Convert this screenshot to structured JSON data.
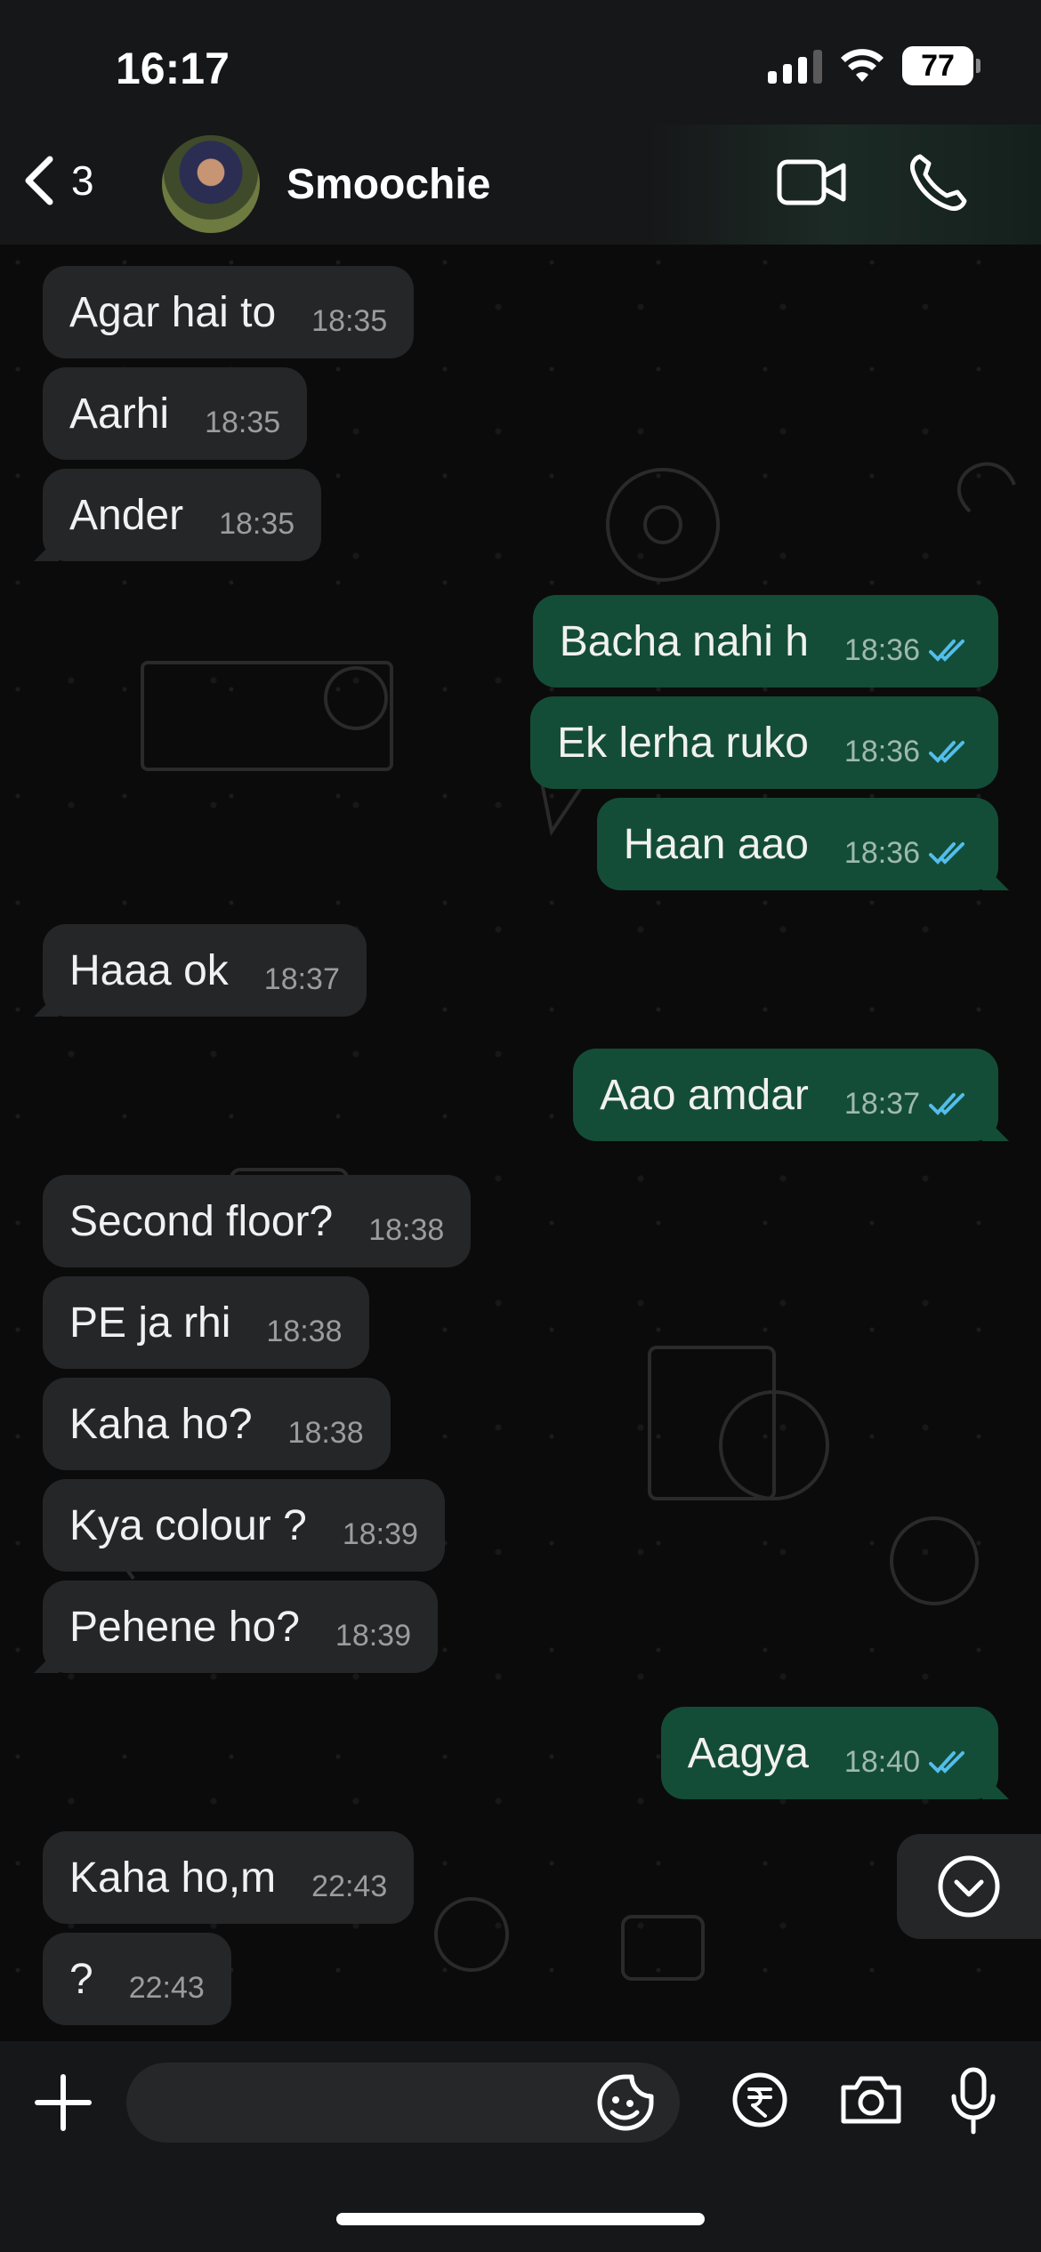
{
  "status_bar": {
    "time": "16:17",
    "battery": "77"
  },
  "header": {
    "back_count": "3",
    "contact_name": "Smoochie",
    "icons": {
      "back": "chevron-left-icon",
      "video": "video-camera-icon",
      "call": "phone-icon"
    }
  },
  "messages": [
    {
      "direction": "in",
      "text": "Agar hai to",
      "time": "18:35"
    },
    {
      "direction": "in",
      "text": "Aarhi",
      "time": "18:35"
    },
    {
      "direction": "in",
      "text": "Ander",
      "time": "18:35"
    },
    {
      "direction": "out",
      "text": "Bacha nahi h",
      "time": "18:36",
      "status": "read"
    },
    {
      "direction": "out",
      "text": "Ek lerha ruko",
      "time": "18:36",
      "status": "read"
    },
    {
      "direction": "out",
      "text": "Haan aao",
      "time": "18:36",
      "status": "read"
    },
    {
      "direction": "in",
      "text": "Haaa ok",
      "time": "18:37"
    },
    {
      "direction": "out",
      "text": "Aao amdar",
      "time": "18:37",
      "status": "read"
    },
    {
      "direction": "in",
      "text": "Second floor?",
      "time": "18:38"
    },
    {
      "direction": "in",
      "text": "PE ja rhi",
      "time": "18:38"
    },
    {
      "direction": "in",
      "text": "Kaha ho?",
      "time": "18:38"
    },
    {
      "direction": "in",
      "text": "Kya colour ?",
      "time": "18:39"
    },
    {
      "direction": "in",
      "text": "Pehene ho?",
      "time": "18:39"
    },
    {
      "direction": "out",
      "text": "Aagya",
      "time": "18:40",
      "status": "read"
    },
    {
      "direction": "in",
      "text": "Kaha ho,m",
      "time": "22:43"
    },
    {
      "direction": "in",
      "text": "?",
      "time": "22:43"
    }
  ],
  "composer": {
    "placeholder": "",
    "icons": {
      "attach": "plus-icon",
      "sticker": "sticker-icon",
      "payment": "rupee-icon",
      "camera": "camera-icon",
      "voice": "microphone-icon"
    }
  },
  "colors": {
    "incoming_bubble": "#242628",
    "outgoing_bubble": "#144d37",
    "read_ticks": "#53bdeb",
    "background": "#0b0b0b"
  }
}
